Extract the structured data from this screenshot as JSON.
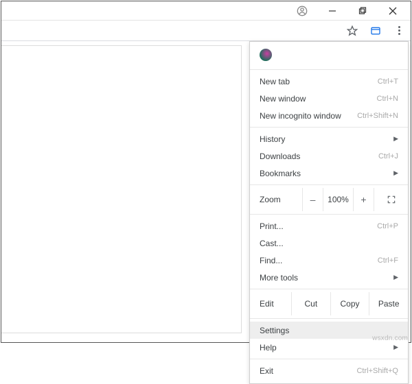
{
  "menu": {
    "new_tab": {
      "label": "New tab",
      "shortcut": "Ctrl+T"
    },
    "new_window": {
      "label": "New window",
      "shortcut": "Ctrl+N"
    },
    "new_incognito": {
      "label": "New incognito window",
      "shortcut": "Ctrl+Shift+N"
    },
    "history": {
      "label": "History"
    },
    "downloads": {
      "label": "Downloads",
      "shortcut": "Ctrl+J"
    },
    "bookmarks": {
      "label": "Bookmarks"
    },
    "zoom": {
      "label": "Zoom",
      "minus": "–",
      "value": "100%",
      "plus": "+"
    },
    "print": {
      "label": "Print...",
      "shortcut": "Ctrl+P"
    },
    "cast": {
      "label": "Cast..."
    },
    "find": {
      "label": "Find...",
      "shortcut": "Ctrl+F"
    },
    "more_tools": {
      "label": "More tools"
    },
    "edit": {
      "label": "Edit",
      "cut": "Cut",
      "copy": "Copy",
      "paste": "Paste"
    },
    "settings": {
      "label": "Settings"
    },
    "help": {
      "label": "Help"
    },
    "exit": {
      "label": "Exit",
      "shortcut": "Ctrl+Shift+Q"
    }
  },
  "watermark": "wsxdn.com"
}
